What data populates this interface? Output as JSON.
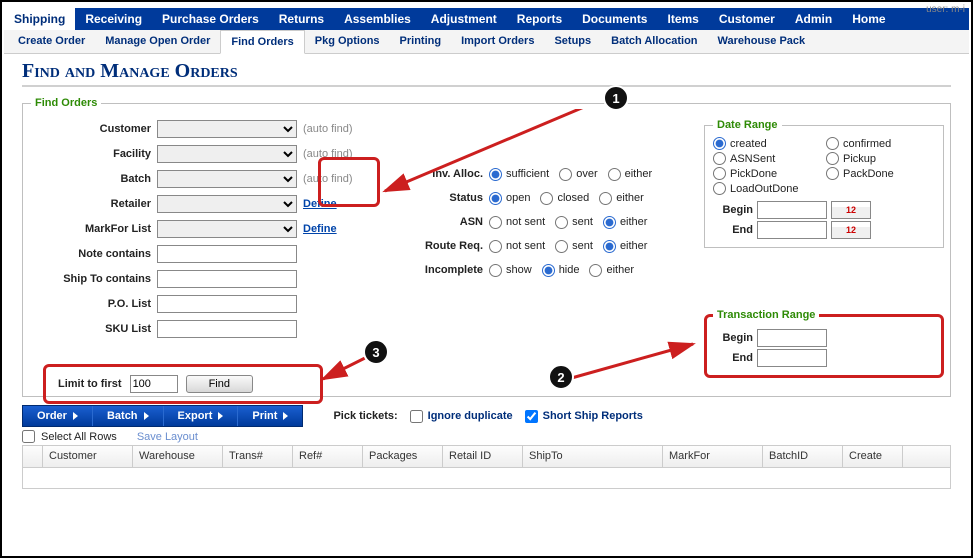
{
  "topright": "user: m-i",
  "nav1": [
    "Shipping",
    "Receiving",
    "Purchase Orders",
    "Returns",
    "Assemblies",
    "Adjustment",
    "Reports",
    "Documents",
    "Items",
    "Customer",
    "Admin",
    "Home"
  ],
  "nav1_active": 0,
  "nav2": [
    "Create Order",
    "Manage Open Order",
    "Find Orders",
    "Pkg Options",
    "Printing",
    "Import Orders",
    "Setups",
    "Batch Allocation",
    "Warehouse Pack"
  ],
  "nav2_active": 2,
  "title": "Find and Manage Orders",
  "find": {
    "legend": "Find Orders",
    "fields": {
      "customer_label": "Customer",
      "facility_label": "Facility",
      "batch_label": "Batch",
      "retailer_label": "Retailer",
      "markfor_label": "MarkFor List",
      "note_label": "Note contains",
      "shipto_label": "Ship To contains",
      "po_label": "P.O. List",
      "sku_label": "SKU List",
      "autofind": "(auto find)",
      "define": "Define"
    }
  },
  "radios": {
    "invalloc": {
      "label": "Inv. Alloc.",
      "opts": [
        "sufficient",
        "over",
        "either"
      ],
      "sel": 0
    },
    "status": {
      "label": "Status",
      "opts": [
        "open",
        "closed",
        "either"
      ],
      "sel": 0
    },
    "asn": {
      "label": "ASN",
      "opts": [
        "not sent",
        "sent",
        "either"
      ],
      "sel": 2
    },
    "routereq": {
      "label": "Route Req.",
      "opts": [
        "not sent",
        "sent",
        "either"
      ],
      "sel": 2
    },
    "incomplete": {
      "label": "Incomplete",
      "opts": [
        "show",
        "hide",
        "either"
      ],
      "sel": 1
    }
  },
  "daterange": {
    "legend": "Date Range",
    "opts": [
      "created",
      "confirmed",
      "ASNSent",
      "Pickup",
      "PickDone",
      "PackDone",
      "LoadOutDone"
    ],
    "sel": 0,
    "begin_label": "Begin",
    "end_label": "End",
    "begin": "",
    "end": "",
    "cal": "12"
  },
  "trange": {
    "legend": "Transaction Range",
    "begin_label": "Begin",
    "end_label": "End",
    "begin": "",
    "end": ""
  },
  "limit": {
    "label": "Limit to first",
    "value": "100",
    "find_btn": "Find"
  },
  "bluemenu": [
    "Order",
    "Batch",
    "Export",
    "Print"
  ],
  "picktickets": {
    "label": "Pick tickets:",
    "ignore": "Ignore duplicate",
    "ignore_checked": false,
    "short": "Short Ship Reports",
    "short_checked": true
  },
  "selrow": {
    "select_all": "Select All Rows",
    "save_layout": "Save Layout"
  },
  "grid_cols": [
    "",
    "Customer",
    "Warehouse",
    "Trans#",
    "Ref#",
    "Packages",
    "Retail ID",
    "ShipTo",
    "MarkFor",
    "BatchID",
    "Create"
  ],
  "grid_widths": [
    20,
    90,
    90,
    70,
    70,
    80,
    80,
    140,
    100,
    80,
    60
  ],
  "callouts": {
    "1": "1",
    "2": "2",
    "3": "3"
  }
}
